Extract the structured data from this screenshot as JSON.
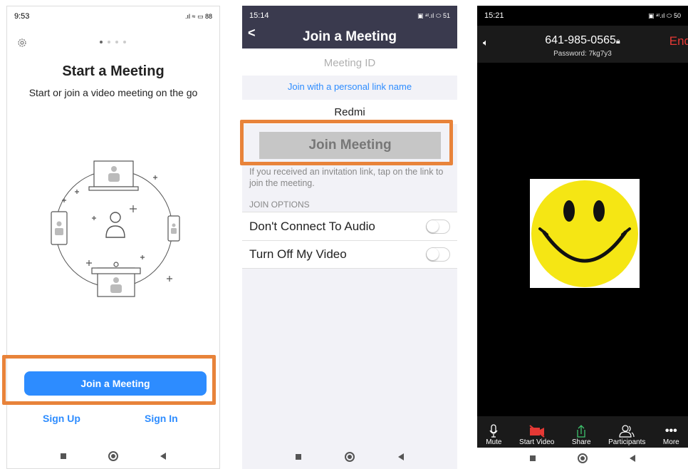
{
  "screen1": {
    "status_time": "9:53",
    "status_right": ".ıl ≈ ▭ 88",
    "title": "Start a Meeting",
    "subtitle": "Start or join a video meeting on the go",
    "join_button": "Join a Meeting",
    "sign_up": "Sign Up",
    "sign_in": "Sign In",
    "gear_icon": "gear-icon"
  },
  "screen2": {
    "status_time": "15:14",
    "status_right": "▣ ᵃᵗ.ıl ⬭ 51",
    "header_title": "Join a Meeting",
    "meeting_id_placeholder": "Meeting ID",
    "personal_link": "Join with a personal link name",
    "name_value": "Redmi",
    "join_button": "Join Meeting",
    "hint": "If you received an invitation link, tap on the link to join the meeting.",
    "section_label": "JOIN OPTIONS",
    "options": [
      {
        "label": "Don't Connect To Audio",
        "on": false
      },
      {
        "label": "Turn Off My Video",
        "on": false
      }
    ]
  },
  "screen3": {
    "status_time": "15:21",
    "status_right": "▣ ᵃᵗ.ıl ⬭ 50",
    "meeting_id": "641-985-0565",
    "password": "Password: 7kg7y3",
    "end_label": "End",
    "toolbar": [
      {
        "label": "Mute",
        "icon": "mic-icon"
      },
      {
        "label": "Start Video",
        "icon": "video-off-icon"
      },
      {
        "label": "Share",
        "icon": "share-icon"
      },
      {
        "label": "Participants",
        "icon": "participants-icon"
      },
      {
        "label": "More",
        "icon": "more-icon"
      }
    ]
  },
  "colors": {
    "accent": "#2d8cff",
    "highlight": "#e8833a",
    "header_dark": "#3a3a4e",
    "end_red": "#e53935",
    "smiley_yellow": "#f5e614"
  }
}
